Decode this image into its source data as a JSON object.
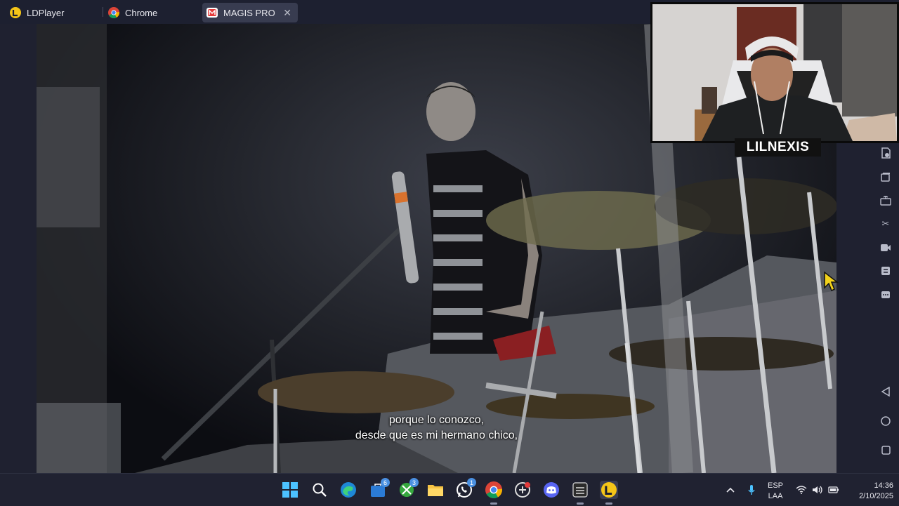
{
  "tabs": [
    {
      "label": "LDPlayer",
      "icon": "ldplayer-icon"
    },
    {
      "label": "Chrome",
      "icon": "chrome-icon"
    },
    {
      "label": "MAGIS PRO",
      "icon": "magis-pro-icon",
      "active": true
    }
  ],
  "video": {
    "subtitle_line1": "porque lo conozco,",
    "subtitle_line2": "desde que es mi hermano chico,"
  },
  "webcam": {
    "streamer_name": "LILNEXIS"
  },
  "emulator_toolbar": {
    "icons": [
      "operation-record-icon",
      "multi-instance-icon",
      "apk-install-icon",
      "scissors-icon",
      "screen-record-icon",
      "sync-icon",
      "more-icon",
      "back-icon",
      "home-icon",
      "recents-icon"
    ]
  },
  "taskbar": {
    "apps": [
      {
        "name": "windows-start-icon"
      },
      {
        "name": "search-icon"
      },
      {
        "name": "edge-icon"
      },
      {
        "name": "store-icon",
        "badge": "6"
      },
      {
        "name": "xbox-icon",
        "badge": "3"
      },
      {
        "name": "file-explorer-icon"
      },
      {
        "name": "whatsapp-icon",
        "badge": "1"
      },
      {
        "name": "chrome-icon"
      },
      {
        "name": "app-icon-red-dot"
      },
      {
        "name": "discord-icon"
      },
      {
        "name": "obs-icon"
      },
      {
        "name": "ldplayer-icon"
      }
    ],
    "language_line1": "ESP",
    "language_line2": "LAA",
    "time": "14:36",
    "date": "2/10/2025"
  },
  "colors": {
    "taskbar_bg": "#202231",
    "tabbar_bg": "#1d2030",
    "active_tab_bg": "#383c50",
    "cursor": "#f2d21b"
  }
}
